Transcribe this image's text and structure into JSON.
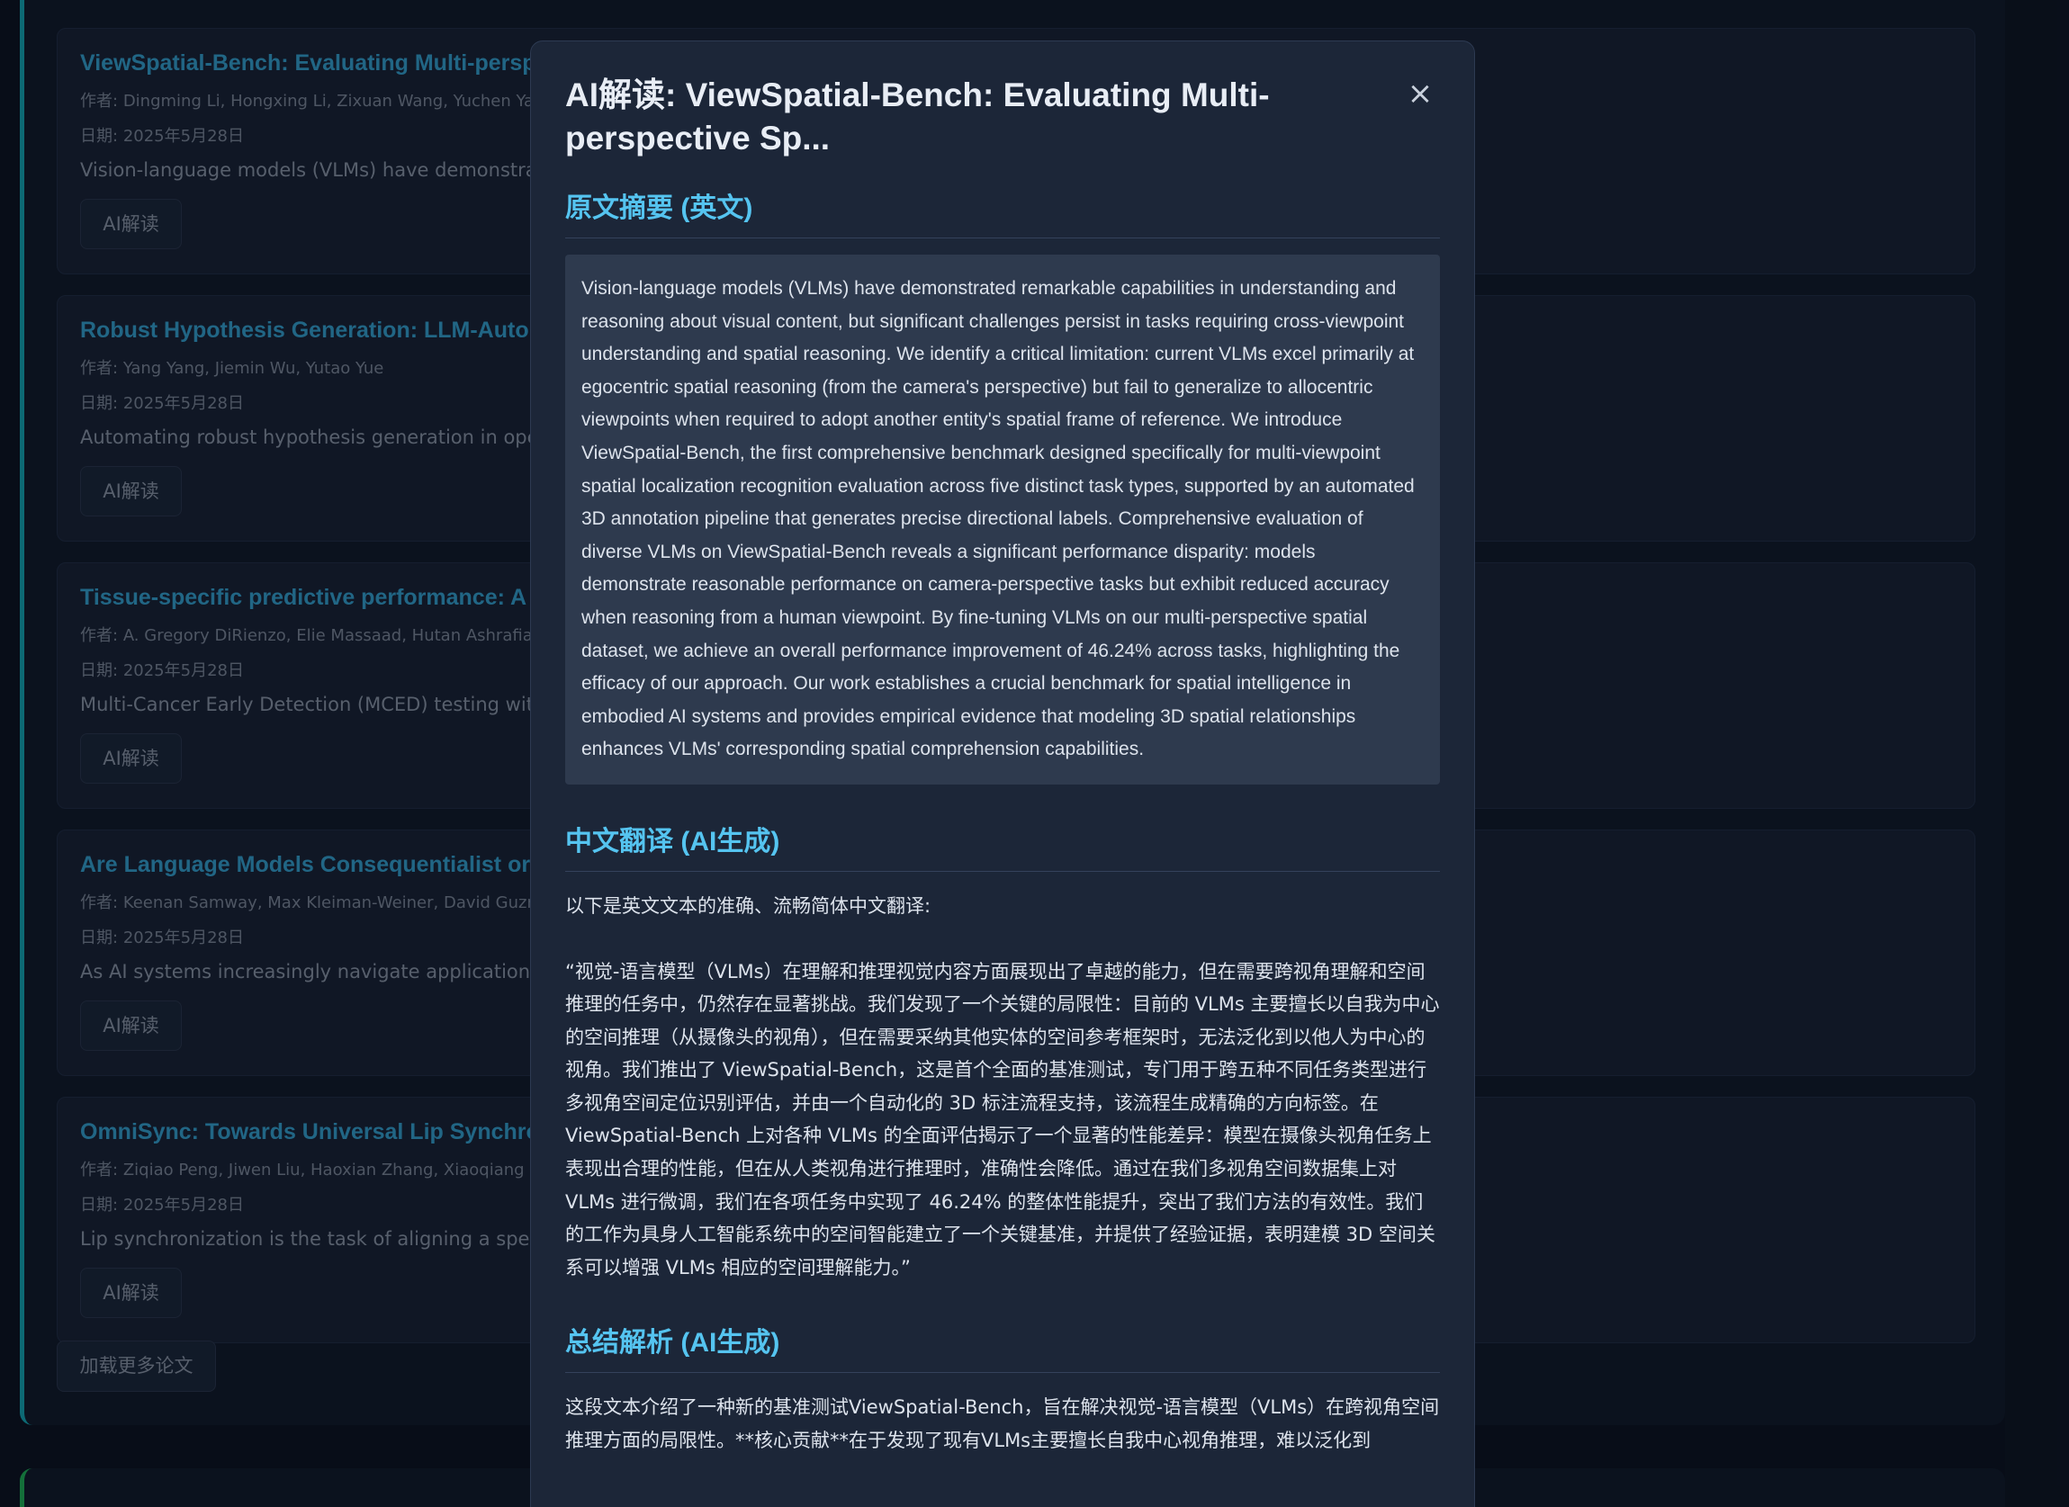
{
  "papers": [
    {
      "title": "ViewSpatial-Bench: Evaluating Multi-perspective Spatial Localization in Vision-Language Models",
      "authors_label": "作者:",
      "authors": "Dingming Li, Hongxing Li, Zixuan Wang, Yuchen Yan,",
      "date_label": "日期:",
      "date": "2025年5月28日",
      "abstract": "Vision-language models (VLMs) have demonstrated remarkable capabilities",
      "ai_button": "AI解读"
    },
    {
      "title": "Robust Hypothesis Generation: LLM-Automated Language Bias",
      "authors_label": "作者:",
      "authors": "Yang Yang, Jiemin Wu, Yutao Yue",
      "date_label": "日期:",
      "date": "2025年5月28日",
      "abstract": "Automating robust hypothesis generation in open environments",
      "ai_button": "AI解读"
    },
    {
      "title": "Tissue-specific predictive performance: A unified estimation",
      "authors_label": "作者:",
      "authors": "A. Gregory DiRienzo, Elie Massaad, Hutan Ashrafian",
      "date_label": "日期:",
      "date": "2025年5月28日",
      "abstract": "Multi-Cancer Early Detection (MCED) testing with tissue",
      "ai_button": "AI解读"
    },
    {
      "title": "Are Language Models Consequentialist or Deontological",
      "authors_label": "作者:",
      "authors": "Keenan Samway, Max Kleiman-Weiner, David Guzman",
      "date_label": "日期:",
      "date": "2025年5月28日",
      "abstract": "As AI systems increasingly navigate applications in",
      "ai_button": "AI解读"
    },
    {
      "title": "OmniSync: Towards Universal Lip Synchronization",
      "authors_label": "作者:",
      "authors": "Ziqiao Peng, Jiwen Liu, Haoxian Zhang, Xiaoqiang Liu",
      "date_label": "日期:",
      "date": "2025年5月28日",
      "abstract": "Lip synchronization is the task of aligning a speaker",
      "ai_button": "AI解读"
    }
  ],
  "load_more": "加载更多论文",
  "modal": {
    "title": "AI解读: ViewSpatial-Bench: Evaluating Multi-perspective Sp...",
    "close": "×",
    "abstract_heading": "原文摘要 (英文)",
    "abstract_text": "Vision-language models (VLMs) have demonstrated remarkable capabilities in understanding and reasoning about visual content, but significant challenges persist in tasks requiring cross-viewpoint understanding and spatial reasoning. We identify a critical limitation: current VLMs excel primarily at egocentric spatial reasoning (from the camera's perspective) but fail to generalize to allocentric viewpoints when required to adopt another entity's spatial frame of reference. We introduce ViewSpatial-Bench, the first comprehensive benchmark designed specifically for multi-viewpoint spatial localization recognition evaluation across five distinct task types, supported by an automated 3D annotation pipeline that generates precise directional labels. Comprehensive evaluation of diverse VLMs on ViewSpatial-Bench reveals a significant performance disparity: models demonstrate reasonable performance on camera-perspective tasks but exhibit reduced accuracy when reasoning from a human viewpoint. By fine-tuning VLMs on our multi-perspective spatial dataset, we achieve an overall performance improvement of 46.24% across tasks, highlighting the efficacy of our approach. Our work establishes a crucial benchmark for spatial intelligence in embodied AI systems and provides empirical evidence that modeling 3D spatial relationships enhances VLMs' corresponding spatial comprehension capabilities.",
    "translation_heading": "中文翻译 (AI生成)",
    "translation_intro": "以下是英文文本的准确、流畅简体中文翻译:",
    "translation_text": "“视觉-语言模型（VLMs）在理解和推理视觉内容方面展现出了卓越的能力，但在需要跨视角理解和空间推理的任务中，仍然存在显著挑战。我们发现了一个关键的局限性：目前的 VLMs 主要擅长以自我为中心的空间推理（从摄像头的视角），但在需要采纳其他实体的空间参考框架时，无法泛化到以他人为中心的视角。我们推出了 ViewSpatial-Bench，这是首个全面的基准测试，专门用于跨五种不同任务类型进行多视角空间定位识别评估，并由一个自动化的 3D 标注流程支持，该流程生成精确的方向标签。在 ViewSpatial-Bench 上对各种 VLMs 的全面评估揭示了一个显著的性能差异：模型在摄像头视角任务上表现出合理的性能，但在从人类视角进行推理时，准确性会降低。通过在我们多视角空间数据集上对 VLMs 进行微调，我们在各项任务中实现了 46.24% 的整体性能提升，突出了我们方法的有效性。我们的工作为具身人工智能系统中的空间智能建立了一个关键基准，并提供了经验证据，表明建模 3D 空间关系可以增强 VLMs 相应的空间理解能力。”",
    "summary_heading": "总结解析 (AI生成)",
    "summary_text": "这段文本介绍了一种新的基准测试ViewSpatial-Bench，旨在解决视觉-语言模型（VLMs）在跨视角空间推理方面的局限性。**核心贡献**在于发现了现有VLMs主要擅长自我中心视角推理，难以泛化到"
  }
}
